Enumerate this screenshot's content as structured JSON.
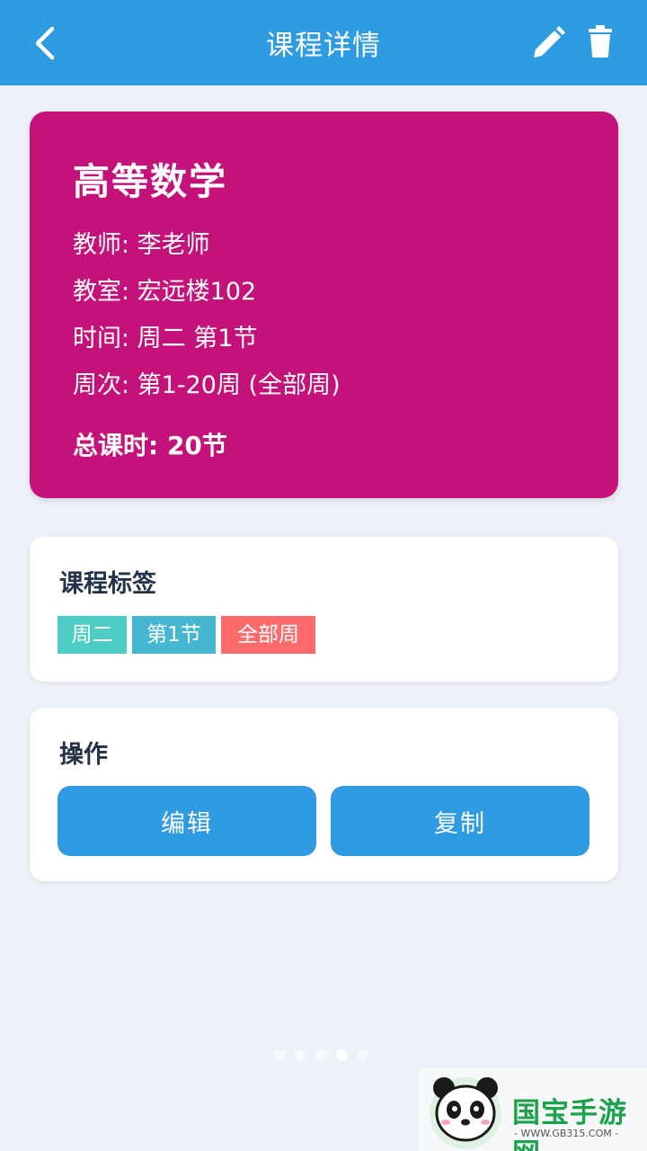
{
  "header": {
    "title": "课程详情"
  },
  "course": {
    "name": "高等数学",
    "teacher": "教师: 李老师",
    "classroom": "教室: 宏远楼102",
    "time": "时间: 周二 第1节",
    "weeks": "周次: 第1-20周 (全部周)",
    "total_hours": "总课时: 20节",
    "color": "#c4127a"
  },
  "tags_panel": {
    "title": "课程标签",
    "tags": [
      {
        "label": "周二",
        "color": "#4ecdc4"
      },
      {
        "label": "第1节",
        "color": "#45b7d1"
      },
      {
        "label": "全部周",
        "color": "#ff6b6b"
      }
    ]
  },
  "actions_panel": {
    "title": "操作",
    "edit_label": "编辑",
    "copy_label": "复制"
  },
  "pager": {
    "count": 5,
    "active_index": 3
  },
  "watermark": {
    "brand": "国宝手游网",
    "url": "- WWW.GB315.COM -"
  },
  "colors": {
    "accent": "#2e9be3",
    "background": "#edf2f9"
  }
}
